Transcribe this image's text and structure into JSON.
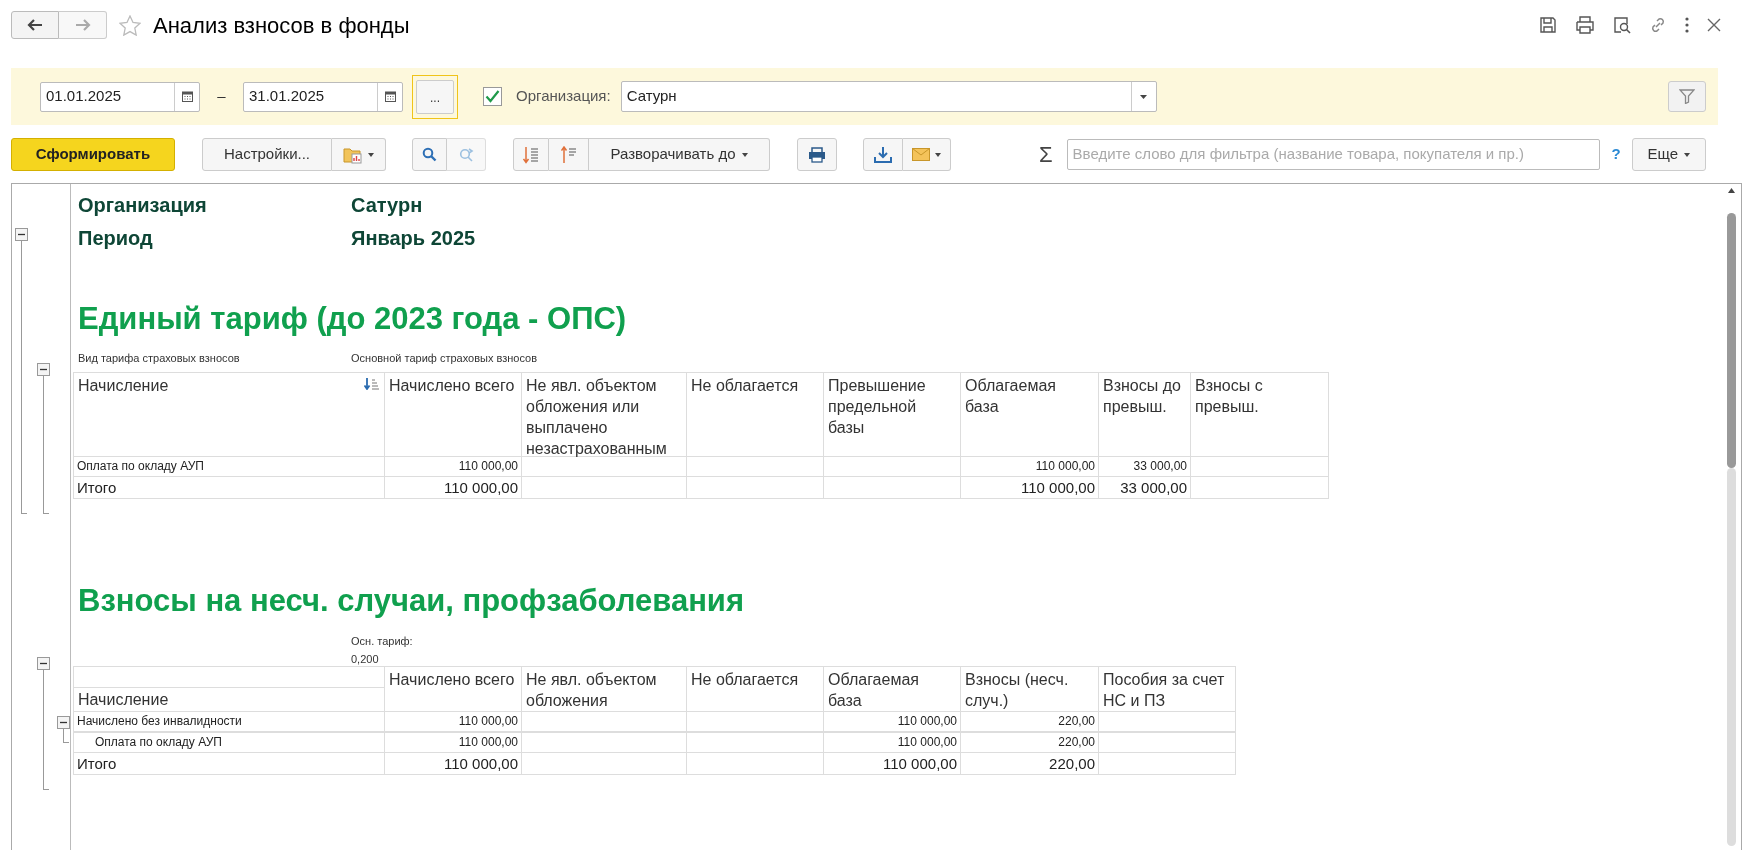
{
  "window": {
    "title": "Анализ взносов в фонды",
    "favorite": false
  },
  "filters": {
    "date_from": "01.01.2025",
    "date_separator": "–",
    "date_to": "31.01.2025",
    "period_button": "...",
    "organization_checked": true,
    "organization_label": "Организация:",
    "organization": "Сатурн"
  },
  "toolbar": {
    "generate": "Сформировать",
    "settings": "Настройки...",
    "expand_to": "Разворачивать до",
    "sum_symbol": "Σ",
    "search_placeholder": "Введите слово для фильтра (название товара, покупателя и пр.)",
    "help": "?",
    "more": "Еще"
  },
  "report": {
    "expanded": true,
    "header": [
      {
        "label": "Организация",
        "value": "Сатурн"
      },
      {
        "label": "Период",
        "value": "Январь 2025"
      }
    ],
    "sections": [
      {
        "title": "Единый тариф (до 2023 года - ОПС)",
        "expanded": true,
        "param_label": "Вид тарифа страховых взносов",
        "param_value": "Основной тариф страховых взносов",
        "columns": [
          {
            "label": "Начисление",
            "sorted": true
          },
          {
            "label": "Начислено всего",
            "sorted": false
          },
          {
            "label": "Не явл. объектом обложения или выплачено незастрахованным",
            "sorted": false
          },
          {
            "label": "Не облагается",
            "sorted": false
          },
          {
            "label": "Превышение предельной базы",
            "sorted": false
          },
          {
            "label": "Облагаемая база",
            "sorted": false
          },
          {
            "label": "Взносы до превыш.",
            "sorted": false
          },
          {
            "label": "Взносы с превыш.",
            "sorted": false
          }
        ],
        "rows": [
          {
            "kind": "row",
            "cells": [
              "Оплата по окладу АУП",
              "110 000,00",
              null,
              null,
              null,
              "110 000,00",
              "33 000,00",
              null
            ]
          },
          {
            "kind": "total",
            "cells": [
              "Итого",
              "110 000,00",
              null,
              null,
              null,
              "110 000,00",
              "33 000,00",
              null
            ]
          }
        ]
      },
      {
        "title": "Взносы на несч. случаи, профзаболевания",
        "expanded": true,
        "param_value": "Осн. тариф: 0,200",
        "columns": [
          {
            "label": "Начисление",
            "sorted": false
          },
          {
            "label": "Начислено всего",
            "sorted": false
          },
          {
            "label": "Не явл. объектом обложения",
            "sorted": false
          },
          {
            "label": "Не облагается",
            "sorted": false
          },
          {
            "label": "Облагаемая база",
            "sorted": false
          },
          {
            "label": "Взносы (несч. случ.)",
            "sorted": false
          },
          {
            "label": "Пособия за счет НС и ПЗ",
            "sorted": false
          }
        ],
        "rows": [
          {
            "kind": "group",
            "expanded": true,
            "cells": [
              "Начислено без инвалидности",
              "110 000,00",
              null,
              null,
              "110 000,00",
              "220,00",
              null
            ],
            "children": [
              {
                "kind": "row",
                "cells": [
                  "Оплата по окладу АУП",
                  "110 000,00",
                  null,
                  null,
                  "110 000,00",
                  "220,00",
                  null
                ]
              }
            ]
          },
          {
            "kind": "total",
            "cells": [
              "Итого",
              "110 000,00",
              null,
              null,
              "110 000,00",
              "220,00",
              null
            ]
          }
        ]
      }
    ]
  }
}
